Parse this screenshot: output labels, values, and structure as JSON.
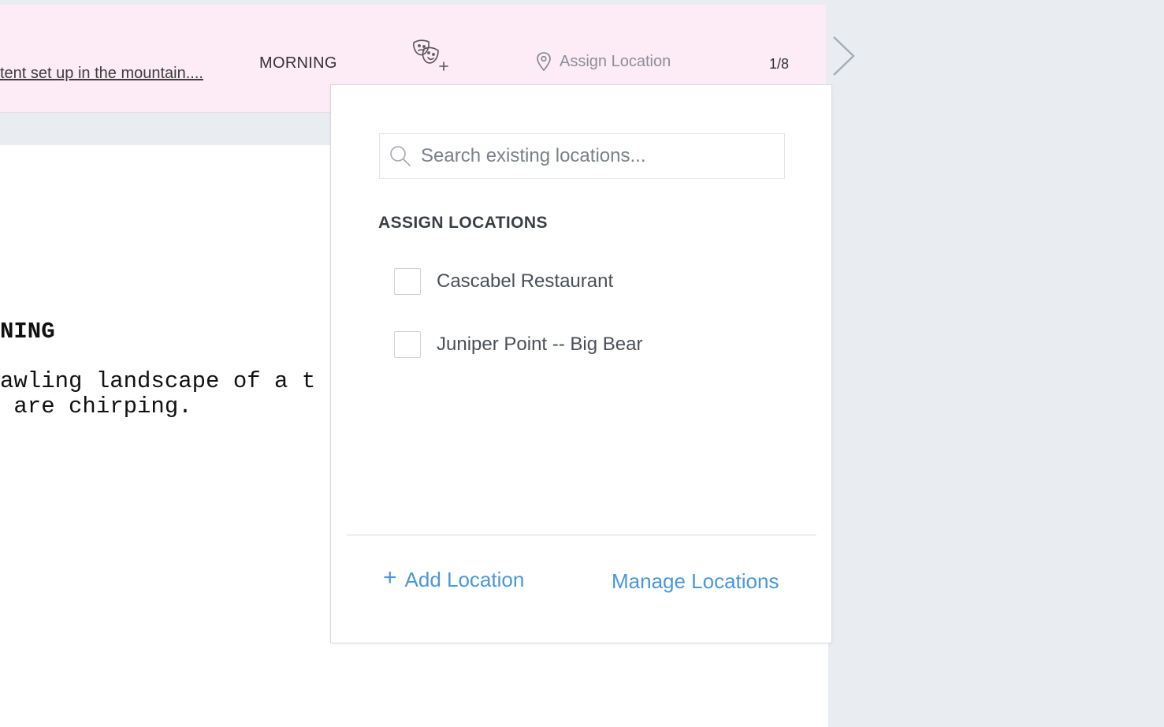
{
  "scene_bar": {
    "description": "tent set up in the mountain....",
    "time_of_day": "MORNING",
    "cast_icon": "theater-masks-add-icon",
    "location_button_label": "Assign Location",
    "location_icon": "map-pin-icon",
    "scene_count": "1/8",
    "next_icon": "chevron-right-icon"
  },
  "script": {
    "heading": "NING",
    "action_lines": "awling landscape of a t\n are chirping."
  },
  "popover": {
    "search": {
      "placeholder": "Search existing locations...",
      "value": "",
      "icon": "search-icon"
    },
    "section_title": "ASSIGN LOCATIONS",
    "locations": [
      {
        "label": "Cascabel Restaurant",
        "checked": false
      },
      {
        "label": "Juniper Point -- Big Bear",
        "checked": false
      }
    ],
    "add_location_label": "Add Location",
    "add_icon": "plus-icon",
    "manage_locations_label": "Manage Locations"
  },
  "colors": {
    "scene_bar_bg": "#fdebf5",
    "link_blue": "#4a97d9",
    "app_bg": "#e9edf1"
  }
}
